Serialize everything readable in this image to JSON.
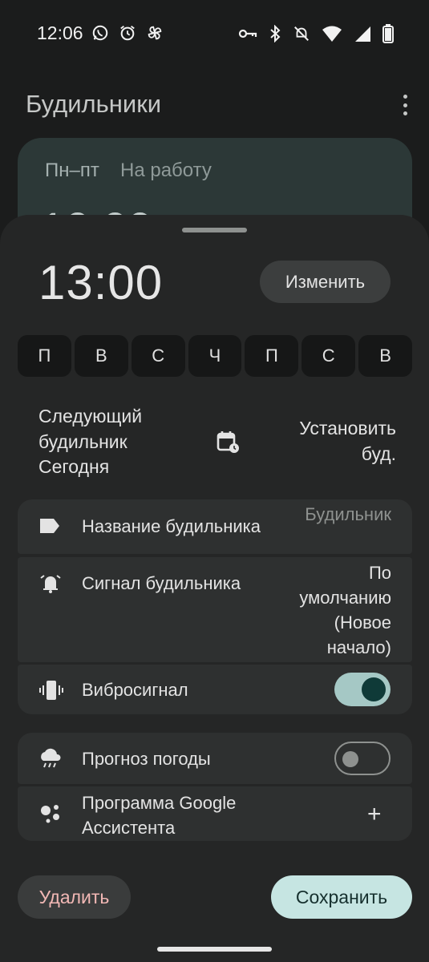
{
  "status_bar": {
    "time": "12:06",
    "left_icons": [
      "whatsapp-icon",
      "alarm-icon",
      "pinwheel-icon"
    ],
    "right_icons": [
      "vpn-key-icon",
      "bluetooth-icon",
      "silent-icon",
      "wifi-icon",
      "cellular-icon",
      "battery-icon"
    ]
  },
  "background": {
    "title": "Будильники",
    "card": {
      "days": "Пн–пт",
      "label": "На работу",
      "time": "10:00"
    }
  },
  "sheet": {
    "time": "13:00",
    "edit_label": "Изменить",
    "days": [
      "П",
      "В",
      "С",
      "Ч",
      "П",
      "С",
      "В"
    ],
    "next_alarm_label": "Следующий будильник",
    "next_alarm_value": "Сегодня",
    "set_alarm_label": "Установить буд.",
    "rows": {
      "name": {
        "label": "Название будильника",
        "value": "Будильник",
        "icon": "label-icon"
      },
      "ringtone": {
        "label": "Сигнал будильника",
        "value": "По умолчанию (Новое начало)",
        "icon": "bell-icon"
      },
      "vibrate": {
        "label": "Вибросигнал",
        "icon": "vibrate-icon",
        "on": true
      },
      "weather": {
        "label": "Прогноз погоды",
        "icon": "weather-icon",
        "on": false
      },
      "assistant": {
        "label": "Программа Google Ассистента",
        "icon": "assistant-icon",
        "action": "+"
      }
    },
    "delete_label": "Удалить",
    "save_label": "Сохранить"
  },
  "colors": {
    "background": "#1b1c1c",
    "sheet": "#252626",
    "row": "#2e3030",
    "accent_toggle": "#a5c8c5",
    "save_button": "#c6e5e2",
    "delete_text": "#f2b8b5"
  }
}
